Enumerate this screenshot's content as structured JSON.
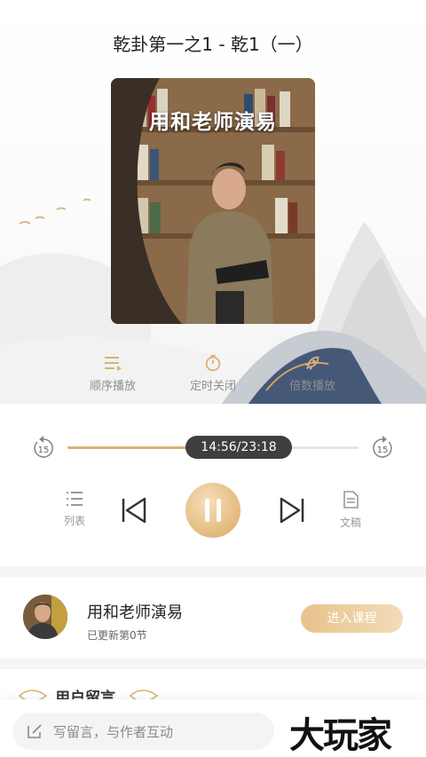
{
  "header": {
    "title": "乾卦第一之1 - 乾1（一）"
  },
  "cover": {
    "title": "用和老师演易"
  },
  "controls": {
    "order": "顺序播放",
    "timer": "定时关闭",
    "speed": "倍数播放"
  },
  "progress": {
    "time": "14:56/23:18",
    "fraction": 0.641,
    "skip_back_seconds": "15",
    "skip_forward_seconds": "15"
  },
  "player": {
    "list_label": "列表",
    "doc_label": "文稿"
  },
  "author": {
    "name": "用和老师演易",
    "update_status": "已更新第0节",
    "enter_button": "进入课程"
  },
  "comments": {
    "title": "用户留言"
  },
  "input": {
    "placeholder": "写留言，与作者互动"
  },
  "watermark": "大玩家",
  "colors": {
    "accent": "#d9b27a",
    "pill": "#3f3f3f",
    "muted_text": "#8f8f8f"
  },
  "icons": [
    "sequence-icon",
    "timer-icon",
    "rocket-icon",
    "skip-back-15-icon",
    "skip-forward-15-icon",
    "list-icon",
    "previous-icon",
    "pause-icon",
    "next-icon",
    "document-icon",
    "edit-icon"
  ]
}
